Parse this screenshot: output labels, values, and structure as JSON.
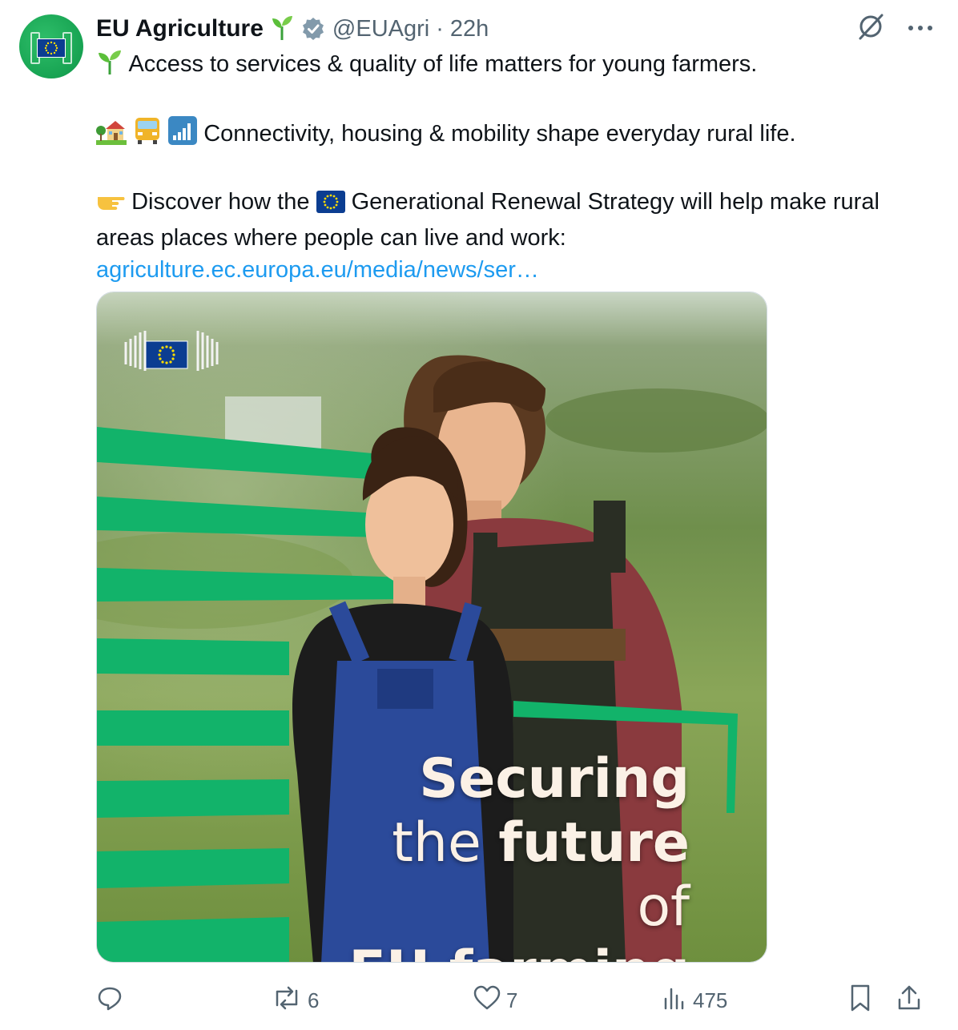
{
  "tweet": {
    "author": {
      "name": "EU Agriculture",
      "handle": "@EUAgri",
      "separator": "·",
      "time": "22h"
    },
    "lines": {
      "l1": "Access to services & quality of life matters for young farmers.",
      "l2": "Connectivity, housing & mobility shape everyday rural life.",
      "l3a": "Discover how the",
      "l3b": "Generational Renewal Strategy will help make rural",
      "l4": "areas places where people can live and work:",
      "link": "agriculture.ec.europa.eu/media/news/ser…"
    },
    "image": {
      "line1": "Securing",
      "line2a": "the",
      "line2b": "future",
      "line2c": "of",
      "line3": "EU farming"
    },
    "stats": {
      "replies": "",
      "reposts": "6",
      "likes": "7",
      "views": "475"
    }
  },
  "colors": {
    "accent_link": "#1d9bf0",
    "brand_green": "#12b36a",
    "eu_blue": "#0b3d91",
    "muted": "#536471"
  }
}
